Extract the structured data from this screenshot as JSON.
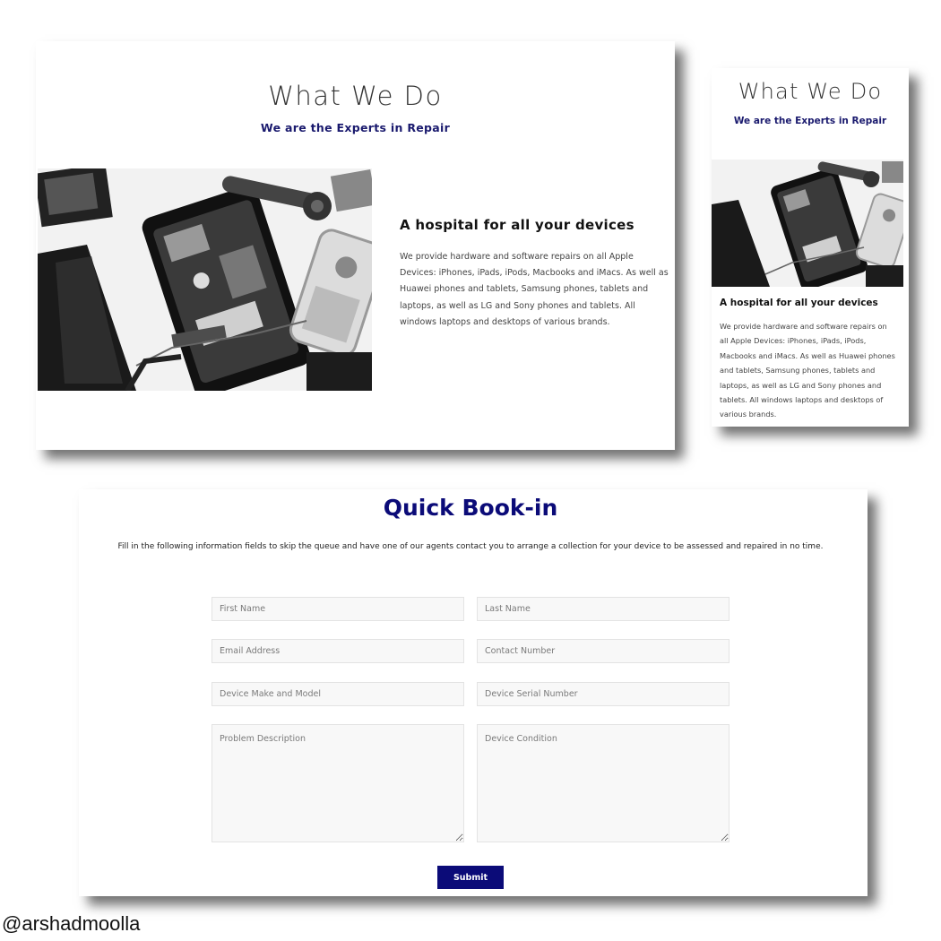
{
  "desktop_section": {
    "title": "What We Do",
    "subtitle": "We are the Experts in Repair",
    "heading": "A hospital for all your devices",
    "body": "We provide hardware and software repairs on all Apple Devices: iPhones, iPads, iPods, Macbooks and iMacs. As well as Huawei phones and tablets, Samsung phones, tablets and laptops, as well as LG and Sony phones and tablets. All windows laptops and desktops of various brands."
  },
  "mobile_section": {
    "title": "What We Do",
    "subtitle": "We are the Experts in Repair",
    "heading": "A hospital for all your devices",
    "body": "We provide hardware and software repairs on all Apple Devices: iPhones, iPads, iPods, Macbooks and iMacs. As well as Huawei phones and tablets, Samsung phones, tablets and laptops, as well as LG and Sony phones and tablets. All windows laptops and desktops of various brands."
  },
  "booking": {
    "title": "Quick Book-in",
    "intro": "Fill in the following information fields to skip the queue and have one of our agents contact you to arrange a collection for your device to be assessed and repaired in no time.",
    "fields": {
      "first_name": "First Name",
      "last_name": "Last Name",
      "email": "Email Address",
      "contact_number": "Contact Number",
      "device_make_model": "Device Make and Model",
      "device_serial": "Device Serial Number",
      "problem_description": "Problem Description",
      "device_condition": "Device Condition"
    },
    "submit_label": "Submit"
  },
  "credit": "@arshadmoolla",
  "colors": {
    "accent": "#0b0b78",
    "subtitle": "#1a1a6e"
  }
}
